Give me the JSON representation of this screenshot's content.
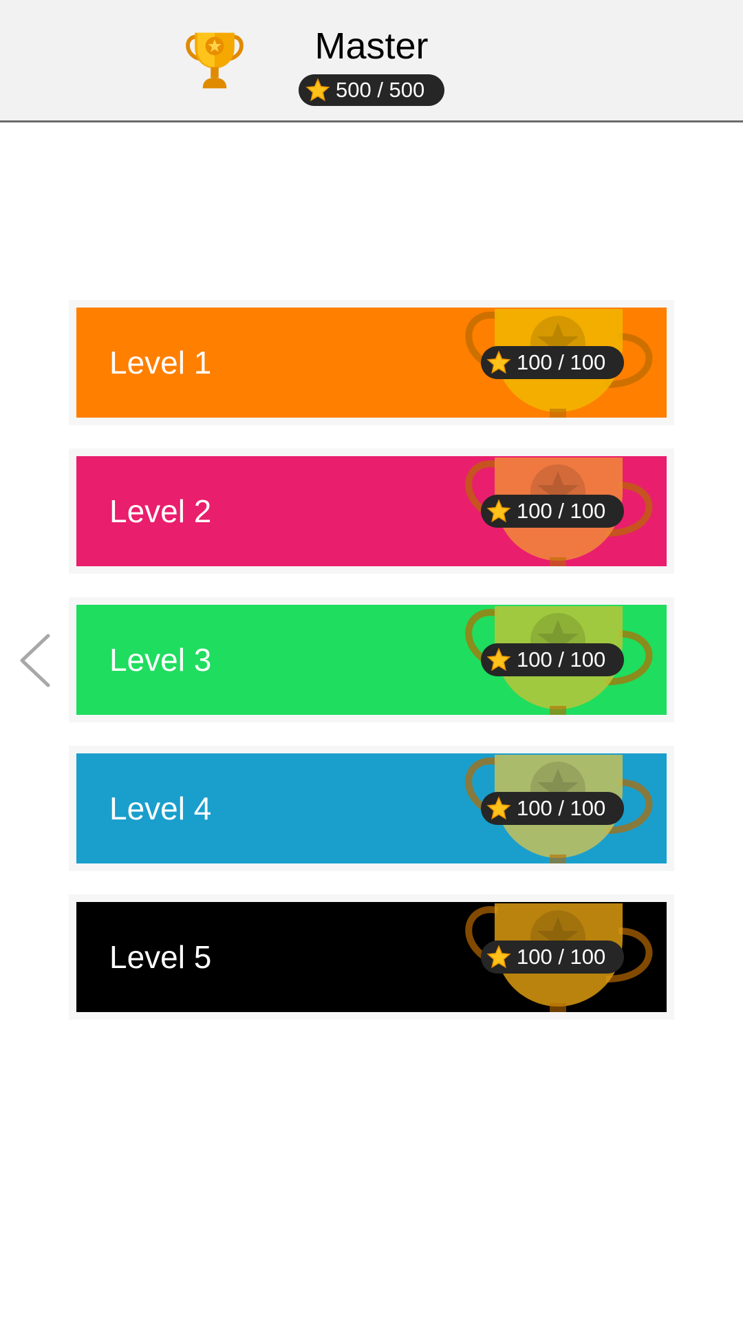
{
  "header": {
    "title": "Master",
    "stars": "500 / 500",
    "trophy_icon": "trophy-icon",
    "star_icon": "star-icon"
  },
  "nav": {
    "back_icon": "chevron-left-icon"
  },
  "levels": [
    {
      "label": "Level 1",
      "stars": "100 / 100",
      "color": "#ff7f00",
      "trophy_tint": "#f2b600"
    },
    {
      "label": "Level 2",
      "stars": "100 / 100",
      "color": "#e91e6d",
      "trophy_tint": "#f08a3a"
    },
    {
      "label": "Level 3",
      "stars": "100 / 100",
      "color": "#1fdd5f",
      "trophy_tint": "#b8c63a"
    },
    {
      "label": "Level 4",
      "stars": "100 / 100",
      "color": "#1a9fcc",
      "trophy_tint": "#c6c05a"
    },
    {
      "label": "Level 5",
      "stars": "100 / 100",
      "color": "#000000",
      "trophy_tint": "#d99a10"
    }
  ]
}
